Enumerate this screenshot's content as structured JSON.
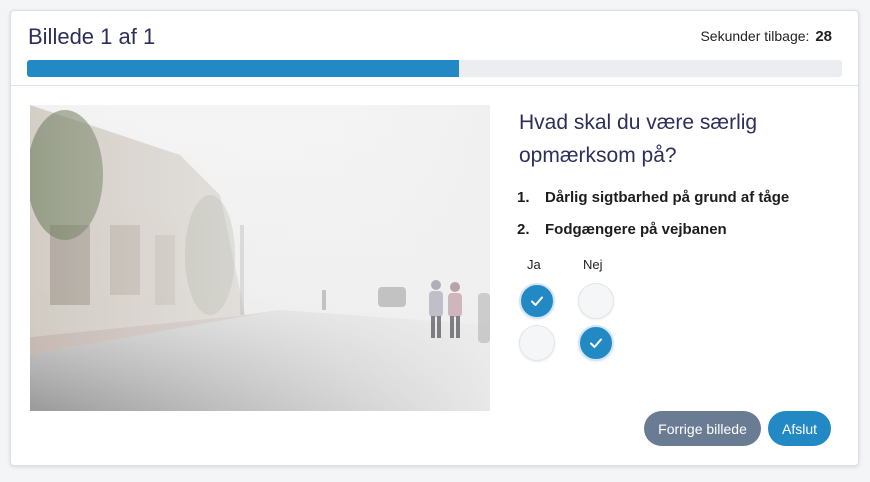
{
  "header": {
    "title": "Billede 1 af 1",
    "timer_label": "Sekunder tilbage:",
    "timer_value": "28",
    "progress_fraction": 0.53
  },
  "question": {
    "text": "Hvad skal du være særlig opmærksom på?",
    "items": [
      {
        "number": "1.",
        "text": "Dårlig sigtbarhed på grund af tåge",
        "answer": "Ja"
      },
      {
        "number": "2.",
        "text": "Fodgængere på vejbanen",
        "answer": "Nej"
      }
    ]
  },
  "answers": {
    "yes_label": "Ja",
    "no_label": "Nej"
  },
  "buttons": {
    "prev": "Forrige billede",
    "finish": "Afslut"
  },
  "colors": {
    "accent": "#2389c4",
    "secondary_button": "#6a7c94",
    "title": "#2c2f5a"
  },
  "icons": {
    "check": "check-icon"
  }
}
